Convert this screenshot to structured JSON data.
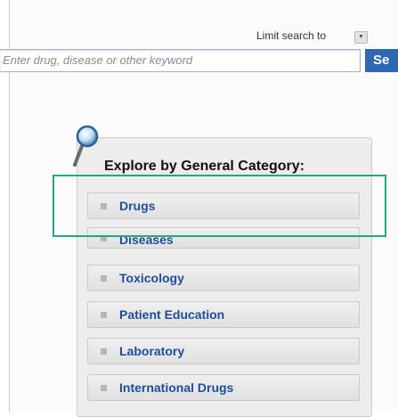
{
  "search": {
    "limit_label": "Limit search to",
    "placeholder": "Enter drug, disease or other keyword",
    "button_label": "Se"
  },
  "explore": {
    "title": "Explore by General Category:",
    "categories": [
      {
        "label": "Drugs"
      },
      {
        "label": "Diseases"
      },
      {
        "label": "Toxicology"
      },
      {
        "label": "Patient Education"
      },
      {
        "label": "Laboratory"
      },
      {
        "label": "International Drugs"
      }
    ]
  },
  "icons": [
    "magnifier-icon",
    "dropdown-arrow-icon",
    "bullet-icon"
  ],
  "colors": {
    "link_blue": "#1f4e99",
    "button_blue": "#2e67b2",
    "highlight_green": "#26a67e"
  }
}
